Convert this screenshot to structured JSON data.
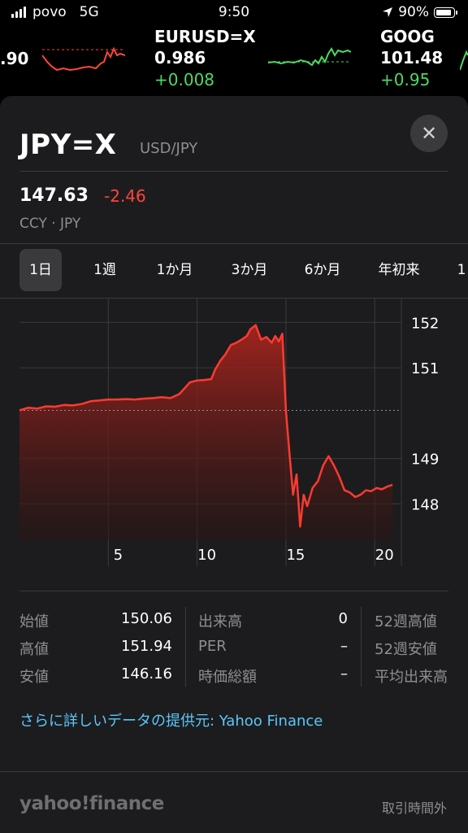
{
  "status_bar": {
    "carrier": "povo",
    "network": "5G",
    "time": "9:50",
    "battery": "90%"
  },
  "ticker_strip": {
    "left_partial_price": ".90",
    "items": [
      {
        "symbol": "EURUSD=X",
        "price": "0.986",
        "change": "+0.008",
        "change_color": "#4cd964"
      },
      {
        "symbol": "GOOG",
        "price": "101.48",
        "change": "+0.95",
        "change_color": "#4cd964"
      }
    ]
  },
  "detail": {
    "symbol": "JPY=X",
    "pair": "USD/JPY",
    "price": "147.63",
    "change": "-2.46",
    "change_color": "#ff453a",
    "exchange": "CCY · JPY",
    "close_icon": "close-icon"
  },
  "range_tabs": {
    "selected": "1日",
    "items": [
      "1日",
      "1週",
      "1か月",
      "3か月",
      "6か月",
      "年初来",
      "1"
    ]
  },
  "chart_data": {
    "type": "area",
    "color": "#ff3b30",
    "xlim": [
      0,
      21.5
    ],
    "ylim": [
      147.2,
      152.4
    ],
    "x_ticks": [
      5,
      10,
      15,
      20
    ],
    "y_ticks": [
      152,
      151,
      149,
      148
    ],
    "y_tick_labels": [
      "152",
      "151",
      "149",
      "148"
    ],
    "reference_value": 150.06,
    "grid": true,
    "series": [
      {
        "x": [
          0,
          0.5,
          1,
          1.5,
          2,
          2.5,
          3,
          3.5,
          4,
          4.5,
          5,
          5.5,
          6,
          6.5,
          7,
          7.5,
          8,
          8.5,
          9,
          9.3,
          9.6,
          10,
          10.4,
          10.8,
          11,
          11.3,
          11.6,
          11.9,
          12.2,
          12.5,
          12.8,
          13.0,
          13.3,
          13.6,
          13.9,
          14.2,
          14.4,
          14.6,
          14.8,
          15.0,
          15.2,
          15.4,
          15.6,
          15.8,
          16.0,
          16.2,
          16.5,
          16.8,
          17.1,
          17.4,
          17.7,
          18.0,
          18.3,
          18.6,
          18.9,
          19.2,
          19.5,
          19.8,
          20.1,
          20.4,
          20.7,
          21.0
        ],
        "y": [
          150.06,
          150.12,
          150.1,
          150.15,
          150.14,
          150.18,
          150.17,
          150.2,
          150.26,
          150.28,
          150.3,
          150.3,
          150.31,
          150.3,
          150.32,
          150.33,
          150.35,
          150.33,
          150.42,
          150.55,
          150.68,
          150.72,
          150.73,
          150.75,
          150.95,
          151.15,
          151.3,
          151.5,
          151.55,
          151.62,
          151.7,
          151.85,
          151.94,
          151.62,
          151.68,
          151.55,
          151.7,
          151.58,
          151.75,
          150.06,
          149.1,
          148.2,
          148.65,
          147.5,
          148.2,
          147.95,
          148.35,
          148.5,
          148.85,
          149.05,
          148.85,
          148.6,
          148.3,
          148.25,
          148.15,
          148.2,
          148.3,
          148.28,
          148.35,
          148.32,
          148.38,
          148.42
        ]
      }
    ]
  },
  "stats": {
    "col1": [
      {
        "label": "始値",
        "value": "150.06"
      },
      {
        "label": "高値",
        "value": "151.94"
      },
      {
        "label": "安値",
        "value": "146.16"
      }
    ],
    "col2": [
      {
        "label": "出来高",
        "value": "0"
      },
      {
        "label": "PER",
        "value": "–"
      },
      {
        "label": "時価総額",
        "value": "–"
      }
    ],
    "col3": [
      {
        "label": "52週高値"
      },
      {
        "label": "52週安値"
      },
      {
        "label": "平均出来高"
      }
    ]
  },
  "more_link": "さらに詳しいデータの提供元: Yahoo Finance",
  "footer": {
    "logo_text": "yahoo!finance",
    "market_status": "取引時間外"
  }
}
